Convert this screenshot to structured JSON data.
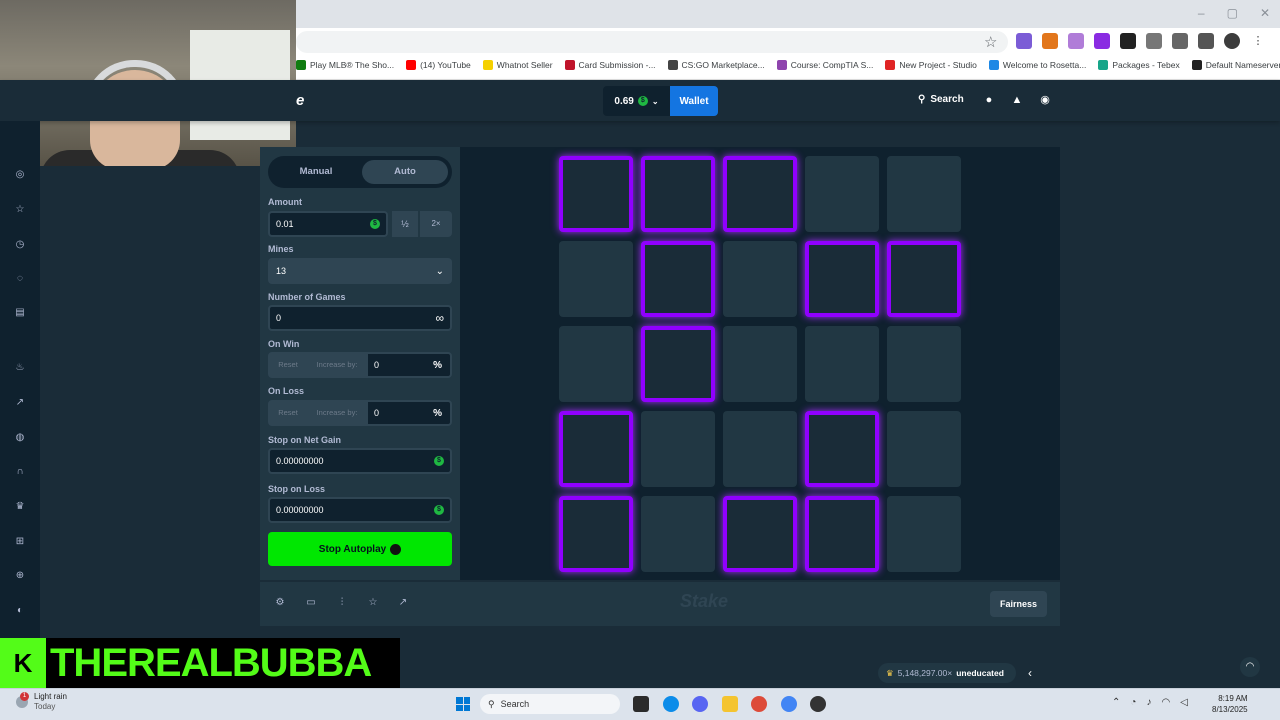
{
  "browser": {
    "bookmarks": [
      {
        "label": "Play MLB® The Sho...",
        "color": "#107c10"
      },
      {
        "label": "(14) YouTube",
        "color": "#ff0000"
      },
      {
        "label": "Whatnot Seller",
        "color": "#f5d000"
      },
      {
        "label": "Card Submission -...",
        "color": "#c0142b"
      },
      {
        "label": "CS:GO Marketplace...",
        "color": "#444444"
      },
      {
        "label": "Course: CompTIA S...",
        "color": "#8e44ad"
      },
      {
        "label": "New Project - Studio",
        "color": "#e02424"
      },
      {
        "label": "Welcome to Rosetta...",
        "color": "#1e88e5"
      },
      {
        "label": "Packages - Tebex",
        "color": "#17a589"
      },
      {
        "label": "Default Nameserver...",
        "color": "#222222"
      }
    ],
    "more_bookmarks": "»"
  },
  "header": {
    "logo_fragment": "e",
    "balance": "0.69",
    "coin_symbol": "$",
    "wallet_label": "Wallet",
    "search_label": "Search"
  },
  "controls": {
    "tabs": {
      "manual": "Manual",
      "auto": "Auto"
    },
    "amount": {
      "label": "Amount",
      "value": "0.01",
      "half": "½",
      "double": "2×"
    },
    "mines": {
      "label": "Mines",
      "value": "13"
    },
    "games": {
      "label": "Number of Games",
      "value": "0",
      "infinity": "∞"
    },
    "on_win": {
      "label": "On Win",
      "reset": "Reset",
      "increase": "Increase by:",
      "value": "0",
      "pct": "%"
    },
    "on_loss": {
      "label": "On Loss",
      "reset": "Reset",
      "increase": "Increase by:",
      "value": "0",
      "pct": "%"
    },
    "stop_gain": {
      "label": "Stop on Net Gain",
      "value": "0.00000000"
    },
    "stop_loss": {
      "label": "Stop on Loss",
      "value": "0.00000000"
    },
    "stop_button": "Stop Autoplay"
  },
  "board": {
    "rows": 5,
    "cols": 5,
    "selected": [
      [
        1,
        1,
        1,
        0,
        0
      ],
      [
        0,
        1,
        0,
        1,
        1
      ],
      [
        0,
        1,
        0,
        0,
        0
      ],
      [
        1,
        0,
        0,
        1,
        0
      ],
      [
        1,
        0,
        1,
        1,
        0
      ]
    ],
    "selected_color": "#9000ff"
  },
  "footer": {
    "logo": "Stake",
    "fairness": "Fairness"
  },
  "stream": {
    "kick_letter": "K",
    "streamer_name": "THEREALBUBBA"
  },
  "win_bubble": {
    "amount": "5,148,297.00×",
    "user": "uneducated"
  },
  "taskbar": {
    "weather_title": "Light rain",
    "weather_sub": "Today",
    "weather_badge": "1",
    "search_label": "Search",
    "time": "8:19 AM",
    "date": "8/13/2025"
  }
}
